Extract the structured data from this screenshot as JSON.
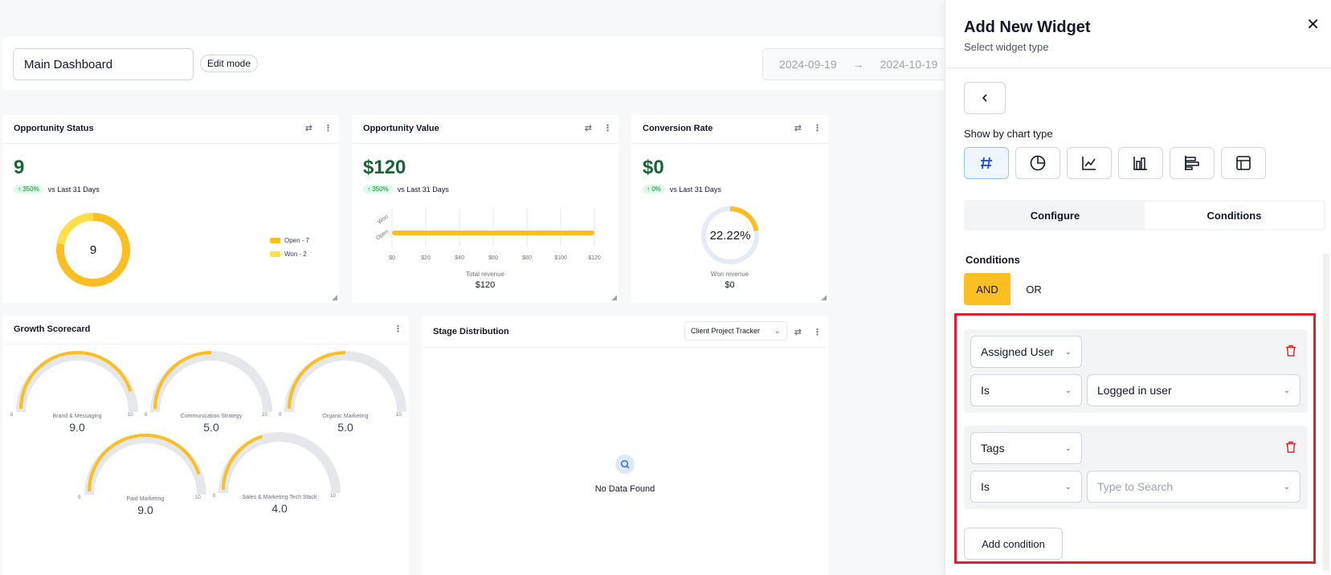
{
  "topbar": {
    "dashboard_name": "Main Dashboard",
    "edit_mode_label": "Edit mode",
    "date_start": "2024-09-19",
    "date_end": "2024-10-19"
  },
  "cards": {
    "opportunity_status": {
      "title": "Opportunity Status",
      "value": "9",
      "delta": "350%",
      "compare": "vs Last 31 Days",
      "center_value": "9",
      "legend": [
        "Open - 7",
        "Won - 2"
      ]
    },
    "opportunity_value": {
      "title": "Opportunity Value",
      "value": "$120",
      "delta": "350%",
      "compare": "vs Last 31 Days",
      "y_labels": [
        "Won",
        "Open"
      ],
      "x_ticks": [
        "$0",
        "$20",
        "$40",
        "$60",
        "$80",
        "$100",
        "$120"
      ],
      "footer_label": "Total revenue",
      "footer_value": "$120"
    },
    "conversion_rate": {
      "title": "Conversion Rate",
      "value": "$0",
      "delta": "0%",
      "compare": "vs Last 31 Days",
      "center_value": "22.22%",
      "footer_label": "Won revenue",
      "footer_value": "$0"
    },
    "growth_scorecard": {
      "title": "Growth Scorecard",
      "gauges": [
        {
          "label": "Brand & Messaging",
          "value": "9.0",
          "min": "0",
          "max": "10"
        },
        {
          "label": "Communication Strategy",
          "value": "5.0",
          "min": "0",
          "max": "10"
        },
        {
          "label": "Organic Marketing",
          "value": "5.0",
          "min": "0",
          "max": "10"
        },
        {
          "label": "Paid Marketing",
          "value": "9.0",
          "min": "0",
          "max": "10"
        },
        {
          "label": "Sales & Marketing Tech Stack",
          "value": "4.0",
          "min": "0",
          "max": "10"
        }
      ]
    },
    "stage_distribution": {
      "title": "Stage Distribution",
      "pipeline": "Client Project Tracker",
      "empty_text": "No Data Found"
    }
  },
  "panel": {
    "title": "Add New Widget",
    "subtitle": "Select widget type",
    "chart_type_label": "Show by chart type",
    "chart_types": [
      "number-icon",
      "pie-icon",
      "line-icon",
      "bar-icon",
      "horizontal-bar-icon",
      "table-icon"
    ],
    "tabs": [
      "Configure",
      "Conditions"
    ],
    "conditions_title": "Conditions",
    "and_label": "AND",
    "or_label": "OR",
    "conditions": [
      {
        "field": "Assigned User",
        "operator": "Is",
        "value": "Logged in user",
        "placeholder": ""
      },
      {
        "field": "Tags",
        "operator": "Is",
        "value": "",
        "placeholder": "Type to Search"
      }
    ],
    "add_condition_label": "Add condition"
  },
  "colors": {
    "accent": "#fbbf24",
    "highlight": "#e11d2e",
    "positive": "#166534"
  }
}
